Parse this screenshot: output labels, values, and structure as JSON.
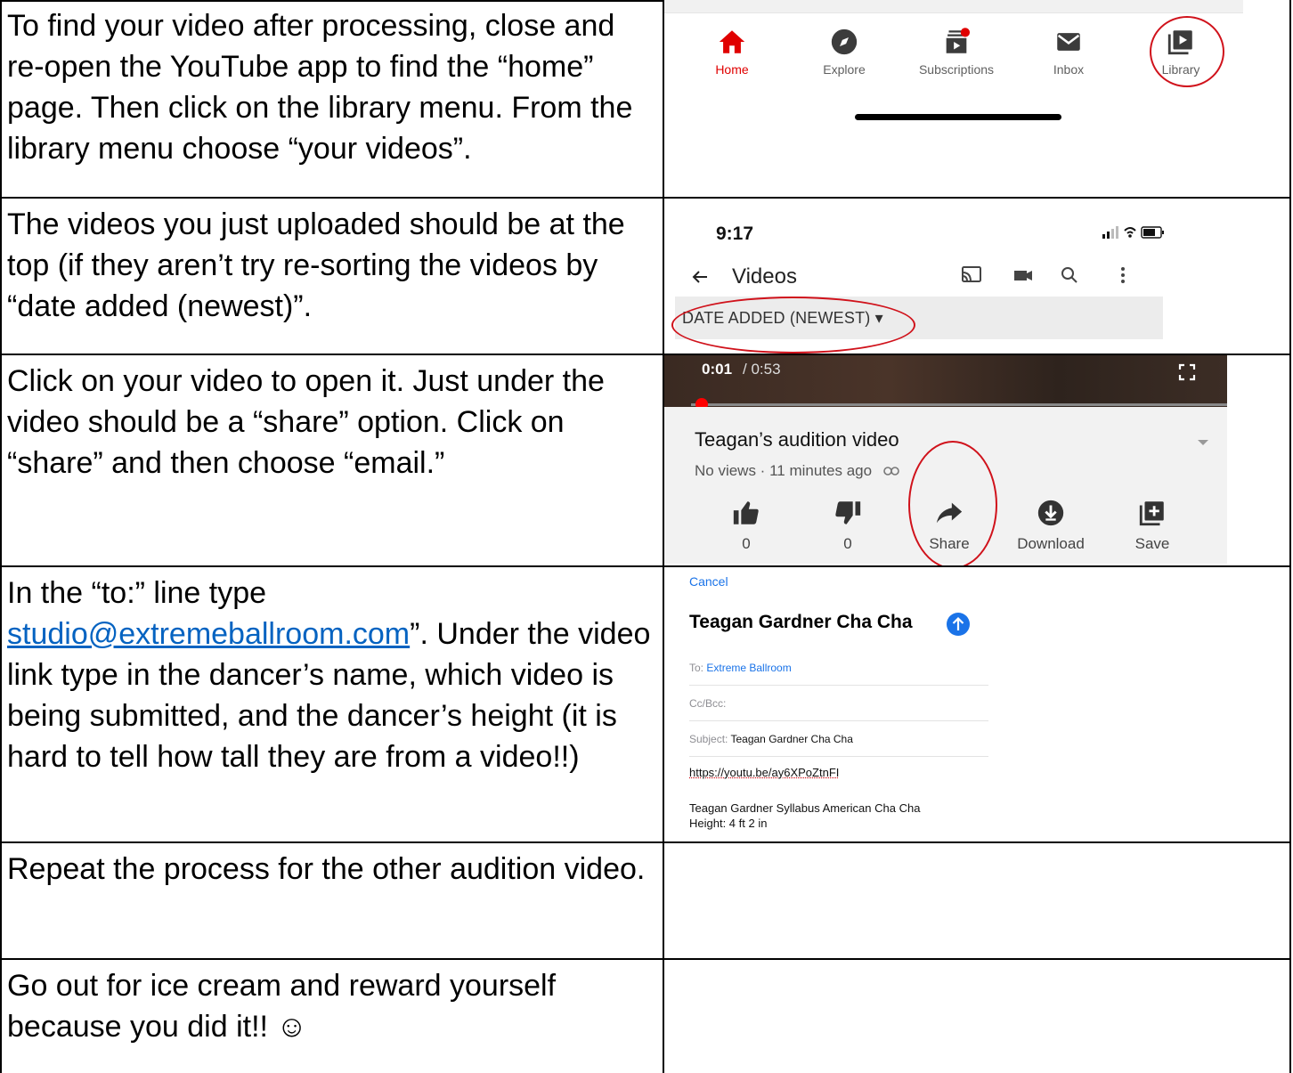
{
  "rows": [
    {
      "text": "To find your video after processing, close and re-open the YouTube app to find the “home” page. Then click on the library menu. From the library menu choose “your videos”."
    },
    {
      "text": "The videos you just uploaded should be at the top (if they aren’t try re-sorting the videos by “date added (newest)”."
    },
    {
      "text": "Click on your video to open it. Just under the video should be a “share” option. Click on “share” and then choose “email.”"
    },
    {
      "text_before": "In the “to:” line type ",
      "link": "studio@extremeballroom.com",
      "text_after": "”. Under the video link type in the dancer’s name, which video is being submitted, and the dancer’s height (it is hard to tell how tall they are from a video!!)"
    },
    {
      "text": "Repeat the process for the other audition video."
    },
    {
      "text": "Go out for ice cream and reward yourself because you did it!! ☺"
    }
  ],
  "nav": {
    "items": [
      {
        "label": "Home",
        "icon": "home-icon"
      },
      {
        "label": "Explore",
        "icon": "compass-icon"
      },
      {
        "label": "Subscriptions",
        "icon": "subscriptions-icon"
      },
      {
        "label": "Inbox",
        "icon": "mail-icon"
      },
      {
        "label": "Library",
        "icon": "library-icon"
      }
    ],
    "active_color": "#e00000"
  },
  "videos_screen": {
    "time": "9:17",
    "title": "Videos",
    "sort_label": "DATE ADDED (NEWEST) ▾"
  },
  "player": {
    "current_time": "0:01",
    "total_time": "/ 0:53",
    "progress": 0.02,
    "video_title": "Teagan’s audition video",
    "meta": "No views · 11 minutes ago",
    "actions": [
      {
        "label": "0",
        "icon": "thumbs-up-icon"
      },
      {
        "label": "0",
        "icon": "thumbs-down-icon"
      },
      {
        "label": "Share",
        "icon": "share-icon"
      },
      {
        "label": "Download",
        "icon": "download-icon"
      },
      {
        "label": "Save",
        "icon": "save-icon"
      }
    ]
  },
  "email": {
    "cancel": "Cancel",
    "subject_title": "Teagan Gardner Cha Cha",
    "to_label": "To:",
    "to_value": "Extreme Ballroom",
    "cc_label": "Cc/Bcc:",
    "subject_label": "Subject:",
    "subject_value": "Teagan Gardner Cha Cha",
    "url": "https://youtu.be/ay6XPoZtnFI",
    "body_line1": "Teagan Gardner Syllabus American Cha Cha",
    "body_line2": "Height: 4 ft 2 in"
  },
  "colors": {
    "highlight_circle": "#d0121b",
    "link": "#0563c1",
    "youtube_red": "#ff0000"
  }
}
